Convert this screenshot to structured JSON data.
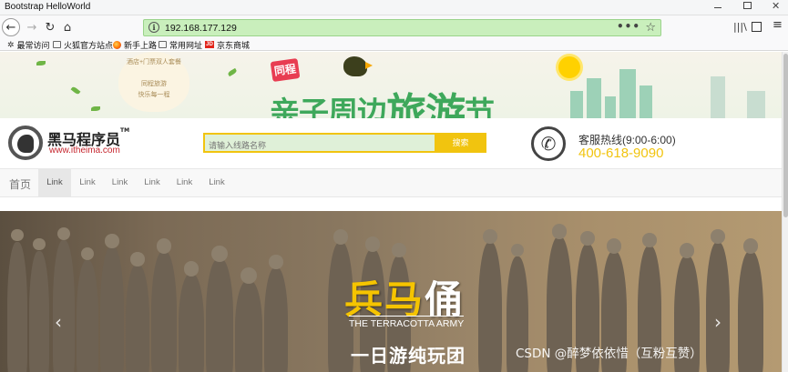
{
  "browser": {
    "tab_title": "Bootstrap HelloWorld",
    "url": "192.168.177.129",
    "page_actions": "•••",
    "bookmarks": [
      "最常访问",
      "火狐官方站点",
      "新手上路",
      "常用网址",
      "京东商城"
    ],
    "jd_mark": "JD"
  },
  "ad": {
    "badge": "同程",
    "headline_a": "亲子周边",
    "headline_b": "旅游",
    "headline_c": "节",
    "cloud_line1": "酒店+门票双人套餐",
    "cloud_line2": "同程旅游",
    "cloud_line3": "快乐每一程"
  },
  "header": {
    "logo_name": "黑马程序员",
    "logo_tm": "TM",
    "logo_url": "www.itheima.com",
    "search_placeholder": "请输入线路名称",
    "search_button": "搜索",
    "hotline_label": "客服热线(9:00-6:00)",
    "hotline_number": "400-618-9090"
  },
  "nav": {
    "brand": "首页",
    "links": [
      "Link",
      "Link",
      "Link",
      "Link",
      "Link",
      "Link"
    ]
  },
  "hero": {
    "title_yellow": "兵马",
    "title_white": "俑",
    "title_en": "THE TERRACOTTA ARMY",
    "subtitle": "一日游纯玩团",
    "prev": "‹",
    "next": "›"
  },
  "watermark": "CSDN @醉梦依依惜（互粉互赞）"
}
